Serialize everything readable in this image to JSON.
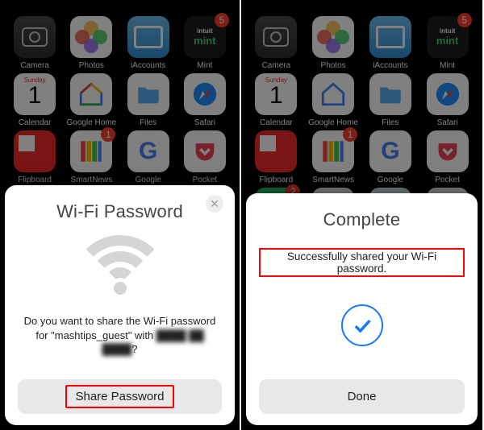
{
  "homescreen": {
    "rows": [
      [
        {
          "name": "camera",
          "label": "Camera"
        },
        {
          "name": "photos",
          "label": "Photos"
        },
        {
          "name": "iaccounts",
          "label": "iAccounts"
        },
        {
          "name": "mint",
          "label": "Mint",
          "badge": "5",
          "intuit": "intuit",
          "brand": "mint"
        }
      ],
      [
        {
          "name": "calendar",
          "label": "Calendar",
          "weekday": "Sunday",
          "day": "1"
        },
        {
          "name": "google-home",
          "label": "Google Home"
        },
        {
          "name": "files",
          "label": "Files"
        },
        {
          "name": "safari",
          "label": "Safari"
        }
      ],
      [
        {
          "name": "flipboard",
          "label": "Flipboard"
        },
        {
          "name": "smartnews",
          "label": "SmartNews",
          "badge": "1"
        },
        {
          "name": "google",
          "label": "Google",
          "glyph": "G"
        },
        {
          "name": "pocket",
          "label": "Pocket"
        }
      ],
      [
        {
          "name": "whatsapp",
          "label": "",
          "badge": "2"
        },
        {
          "name": "messenger",
          "label": ""
        },
        {
          "name": "maps",
          "label": ""
        },
        {
          "name": "slack",
          "label": ""
        }
      ]
    ]
  },
  "share_sheet": {
    "title": "Wi-Fi Password",
    "prompt_prefix": "Do you want to share the Wi-Fi password for \"",
    "network_name": "mashtips_guest",
    "prompt_mid": "\" with ",
    "prompt_suffix": "?",
    "redacted_name": "████ ██",
    "redacted_name2": "████",
    "button": "Share Password",
    "close": "✕"
  },
  "complete_sheet": {
    "title": "Complete",
    "message": "Successfully shared your Wi-Fi password.",
    "button": "Done"
  }
}
